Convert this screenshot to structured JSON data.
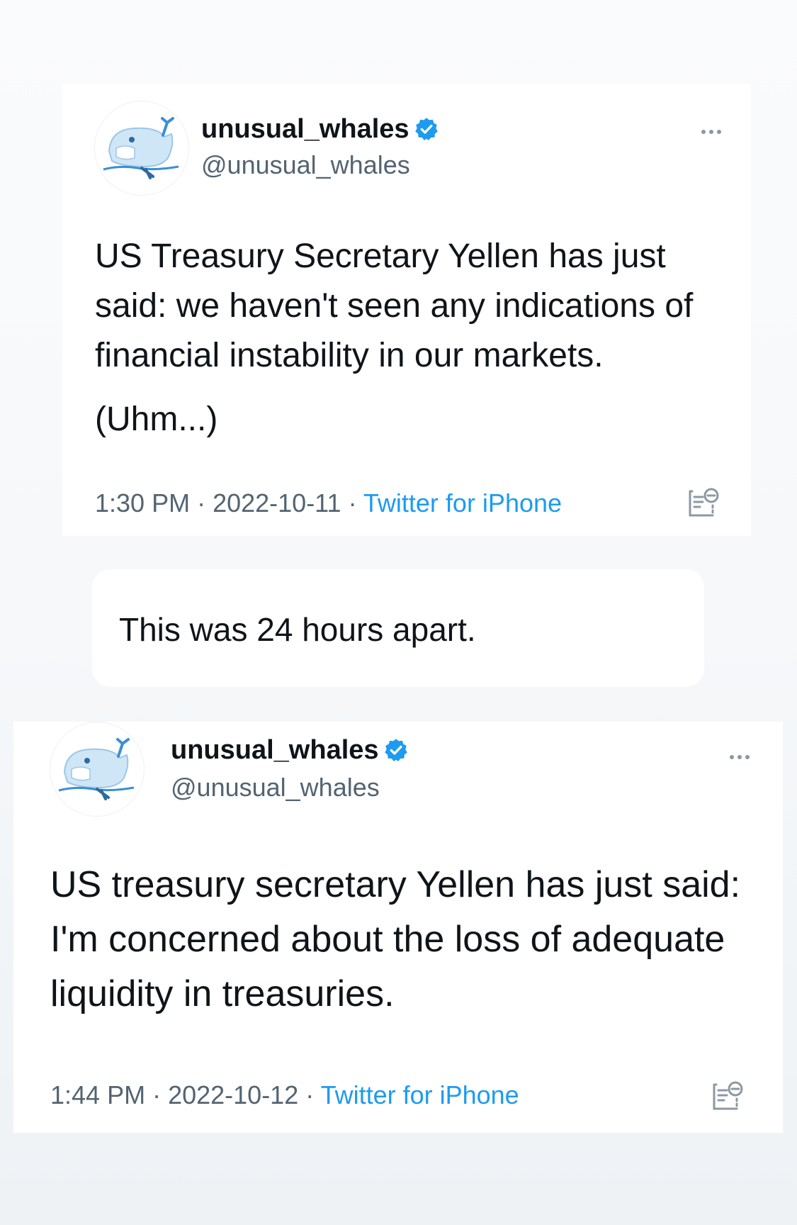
{
  "tweets": [
    {
      "display_name": "unusual_whales",
      "handle": "@unusual_whales",
      "verified": true,
      "text": "US Treasury Secretary Yellen has just said: we haven't seen any indications of financial instability in our markets.",
      "tail": "(Uhm...)",
      "time": "1:30 PM",
      "date": "2022-10-11",
      "source": "Twitter for iPhone",
      "separator": " · "
    },
    {
      "display_name": "unusual_whales",
      "handle": "@unusual_whales",
      "verified": true,
      "text": "US treasury secretary Yellen has just said: I'm concerned about the loss of adequate liquidity in treasuries.",
      "time": "1:44 PM",
      "date": "2022-10-12",
      "source": "Twitter for iPhone",
      "separator": " · "
    }
  ],
  "caption": "This was 24 hours apart.",
  "icons": {
    "avatar": "whale-logo-icon",
    "verified": "verified-badge-icon",
    "more": "more-options-icon",
    "reader": "reader-view-icon"
  },
  "colors": {
    "verified_blue": "#1d9bf0",
    "source_link": "#1d9bf0",
    "secondary_text": "#536471",
    "primary_text": "#0f1419"
  }
}
